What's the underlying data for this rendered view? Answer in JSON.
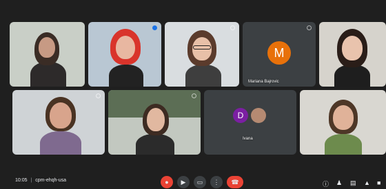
{
  "participants": [
    {
      "name": ""
    },
    {
      "name": ""
    },
    {
      "name": ""
    },
    {
      "name": "Mariana Bajrovic",
      "initial": "M"
    },
    {
      "name": ""
    },
    {
      "name": ""
    },
    {
      "name": ""
    },
    {
      "name": "Ivana",
      "initial": "D"
    },
    {
      "name": ""
    }
  ],
  "meeting": {
    "time": "10:05",
    "separator": "|",
    "code": "cpm-ehqh-usa"
  },
  "controls": {
    "mic_icon": "mic-off-icon",
    "camera_icon": "camera-icon",
    "captions_icon": "captions-icon",
    "more_icon": "more-vert-icon",
    "end_call_icon": "call-end-icon"
  },
  "colors": {
    "background": "#1f1f1f",
    "end_call": "#ea4335",
    "avatar_m": "#e8710a",
    "avatar_d": "#7b1fa2"
  }
}
